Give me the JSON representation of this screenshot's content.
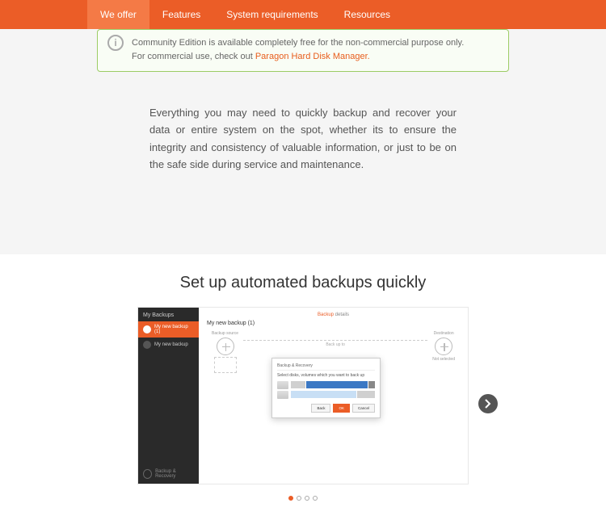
{
  "nav": {
    "items": [
      "We offer",
      "Features",
      "System requirements",
      "Resources"
    ],
    "active": 0
  },
  "notice": {
    "line1": "Community Edition is available completely free for the non-commercial purpose only.",
    "line2_pre": "For commercial use, check out ",
    "line2_link": "Paragon Hard Disk Manager."
  },
  "intro": "Everything you may need to quickly backup and recover your data or entire system on the spot, whether its to ensure the integrity and consistency of valuable information, or just to be on the safe side during service and maintenance.",
  "feature": {
    "heading": "Set up automated backups quickly"
  },
  "shot": {
    "sidebar_title": "My Backups",
    "job_selected": "My new backup (1)",
    "job_other": "My new backup",
    "footer": "Backup & Recovery"
  },
  "panel": {
    "title": "My new backup (1)",
    "tab_active": "Backup",
    "tab_inactive": "details",
    "src_label": "Backup source",
    "mid_label": "Back up to",
    "dst_label": "Destination",
    "dst_sub": "Not selected"
  },
  "dialog": {
    "header": "Backup & Recovery",
    "text": "Select disks, volumes which you want to back up",
    "btn_back": "Back",
    "btn_ok": "OK",
    "btn_cancel": "Cancel"
  },
  "carousel": {
    "current": 0,
    "total": 4
  }
}
